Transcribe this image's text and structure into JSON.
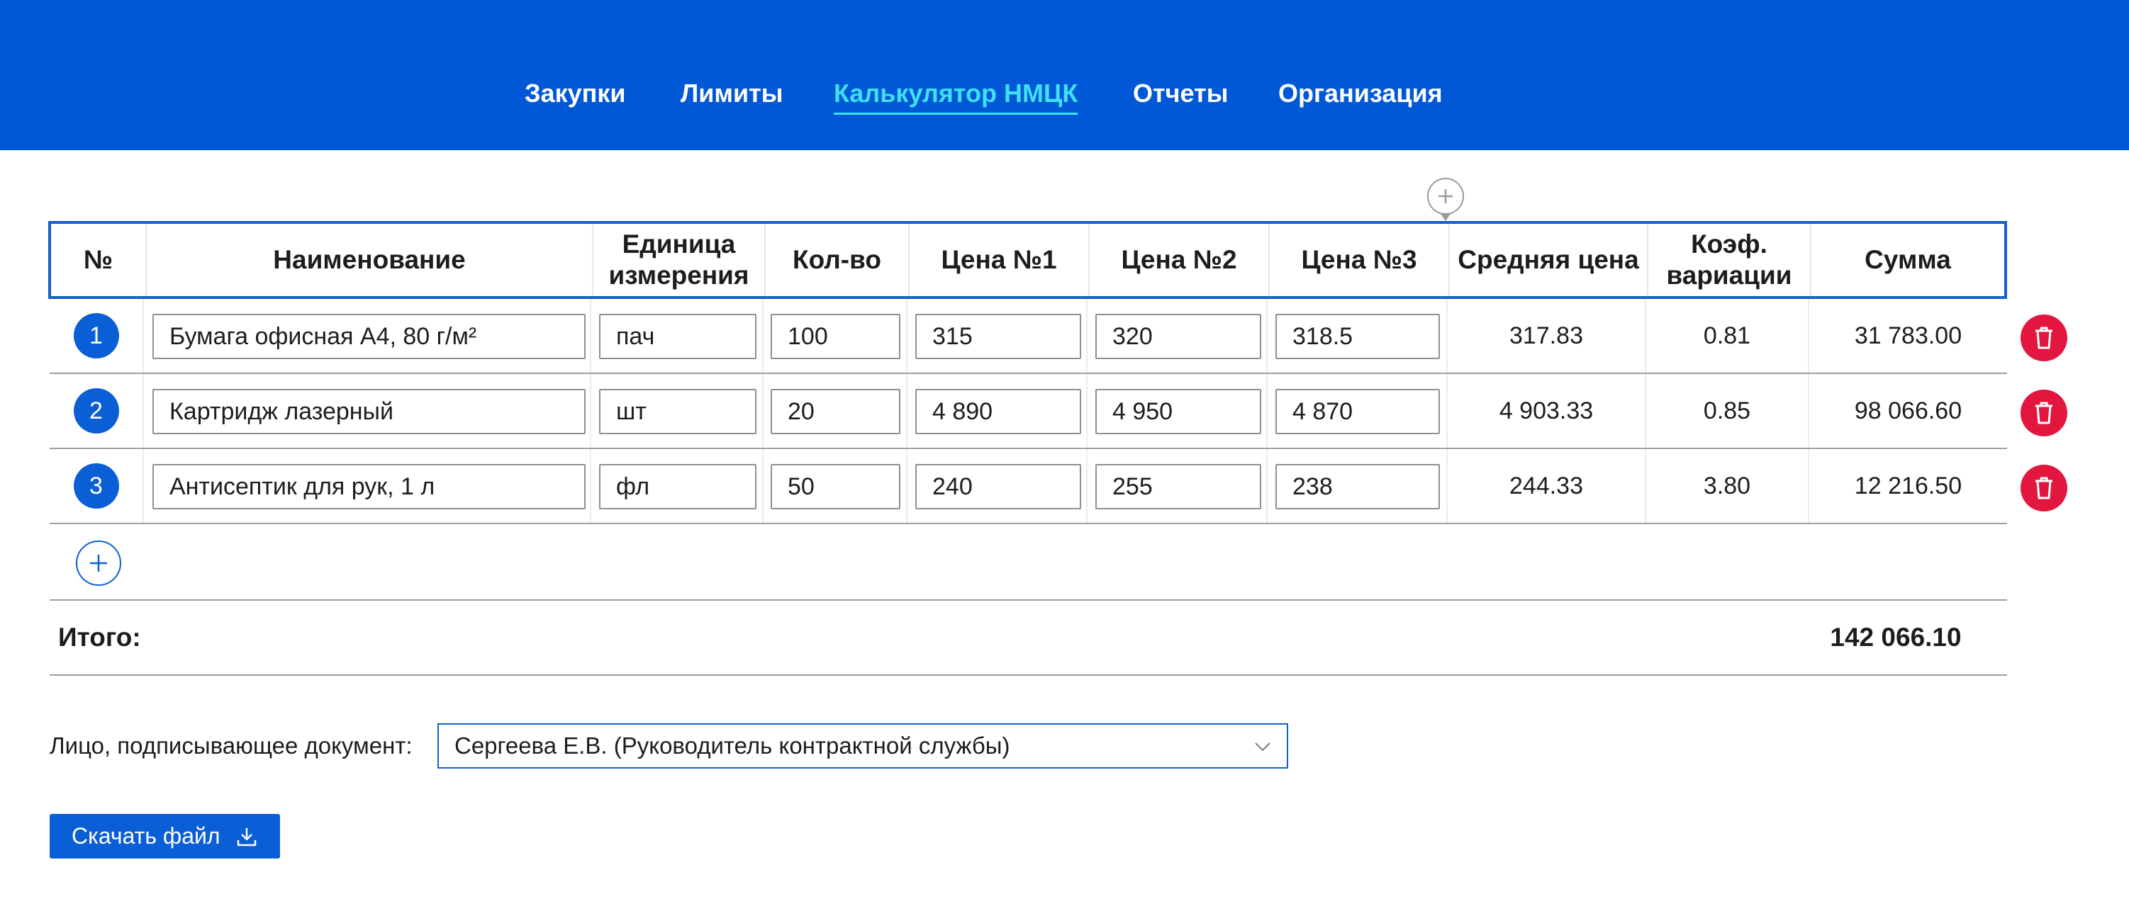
{
  "nav": {
    "items": [
      {
        "label": "Закупки",
        "active": false
      },
      {
        "label": "Лимиты",
        "active": false
      },
      {
        "label": "Калькулятор НМЦК",
        "active": true
      },
      {
        "label": "Отчеты",
        "active": false
      },
      {
        "label": "Организация",
        "active": false
      }
    ]
  },
  "table": {
    "headers": {
      "num": "№",
      "name": "Наименование",
      "unit_line1": "Единица",
      "unit_line2": "измерения",
      "qty": "Кол-во",
      "price1": "Цена №1",
      "price2": "Цена №2",
      "price3": "Цена №3",
      "avg": "Средняя цена",
      "coef_line1": "Коэф.",
      "coef_line2": "вариации",
      "sum": "Сумма"
    },
    "rows": [
      {
        "num": "1",
        "name": "Бумага офисная А4, 80 г/м²",
        "unit": "пач",
        "qty": "100",
        "price1": "315",
        "price2": "320",
        "price3": "318.5",
        "avg": "317.83",
        "coef": "0.81",
        "sum": "31 783.00"
      },
      {
        "num": "2",
        "name": "Картридж лазерный",
        "unit": "шт",
        "qty": "20",
        "price1": "4 890",
        "price2": "4 950",
        "price3": "4 870",
        "avg": "4 903.33",
        "coef": "0.85",
        "sum": "98 066.60"
      },
      {
        "num": "3",
        "name": "Антисептик для рук, 1 л",
        "unit": "фл",
        "qty": "50",
        "price1": "240",
        "price2": "255",
        "price3": "238",
        "avg": "244.33",
        "coef": "3.80",
        "sum": "12 216.50"
      }
    ],
    "total_label": "Итого:",
    "total_value": "142 066.10"
  },
  "signer": {
    "label": "Лицо, подписывающее документ:",
    "value": "Сергеева Е.В. (Руководитель контрактной службы)"
  },
  "download": {
    "label": "Скачать файл"
  },
  "icons": {
    "add_column": "plus-icon",
    "add_row": "plus-icon",
    "delete": "trash-icon",
    "chevron": "chevron-down-icon",
    "download": "download-icon"
  },
  "colors": {
    "header_bg": "#0058d6",
    "active_nav": "#3ee0f2",
    "accent": "#0b5fd6",
    "danger": "#e3163f"
  }
}
